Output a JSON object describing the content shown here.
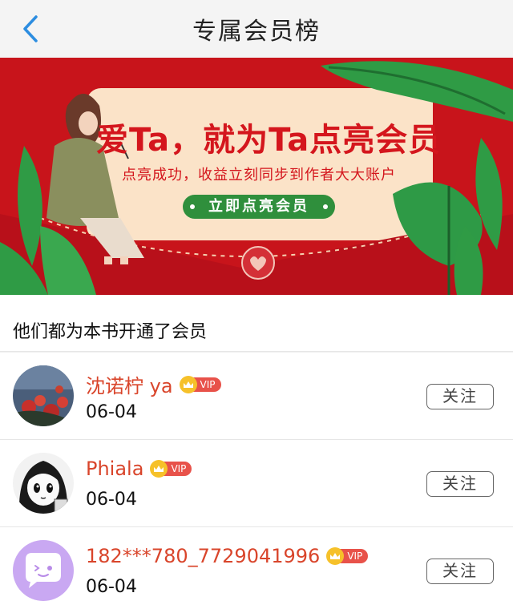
{
  "nav": {
    "title": "专属会员榜",
    "back_icon": "chevron-left-icon"
  },
  "banner": {
    "title": "爱Ta，就为Ta点亮会员",
    "subtitle": "点亮成功，收益立刻同步到作者大大账户",
    "cta": "立即点亮会员",
    "colors": {
      "background": "#c8141b",
      "card": "#fbe3c8",
      "accent_green": "#2f8f3c"
    }
  },
  "section": {
    "title": "他们都为本书开通了会员"
  },
  "members": [
    {
      "name": "沈诺柠 ya",
      "vip": "VIP",
      "date": "06-04",
      "follow": "关注",
      "avatar": "photo-avatar"
    },
    {
      "name": "Phiala",
      "vip": "VIP",
      "date": "06-04",
      "follow": "关注",
      "avatar": "manga-avatar"
    },
    {
      "name": "182***780_7729041996",
      "vip": "VIP",
      "date": "06-04",
      "follow": "关注",
      "avatar": "default-avatar"
    }
  ],
  "colors": {
    "name": "#d9452b",
    "vip_badge": "#e8524a",
    "vip_crown": "#f6c12a",
    "back_icon": "#2c8de0"
  }
}
